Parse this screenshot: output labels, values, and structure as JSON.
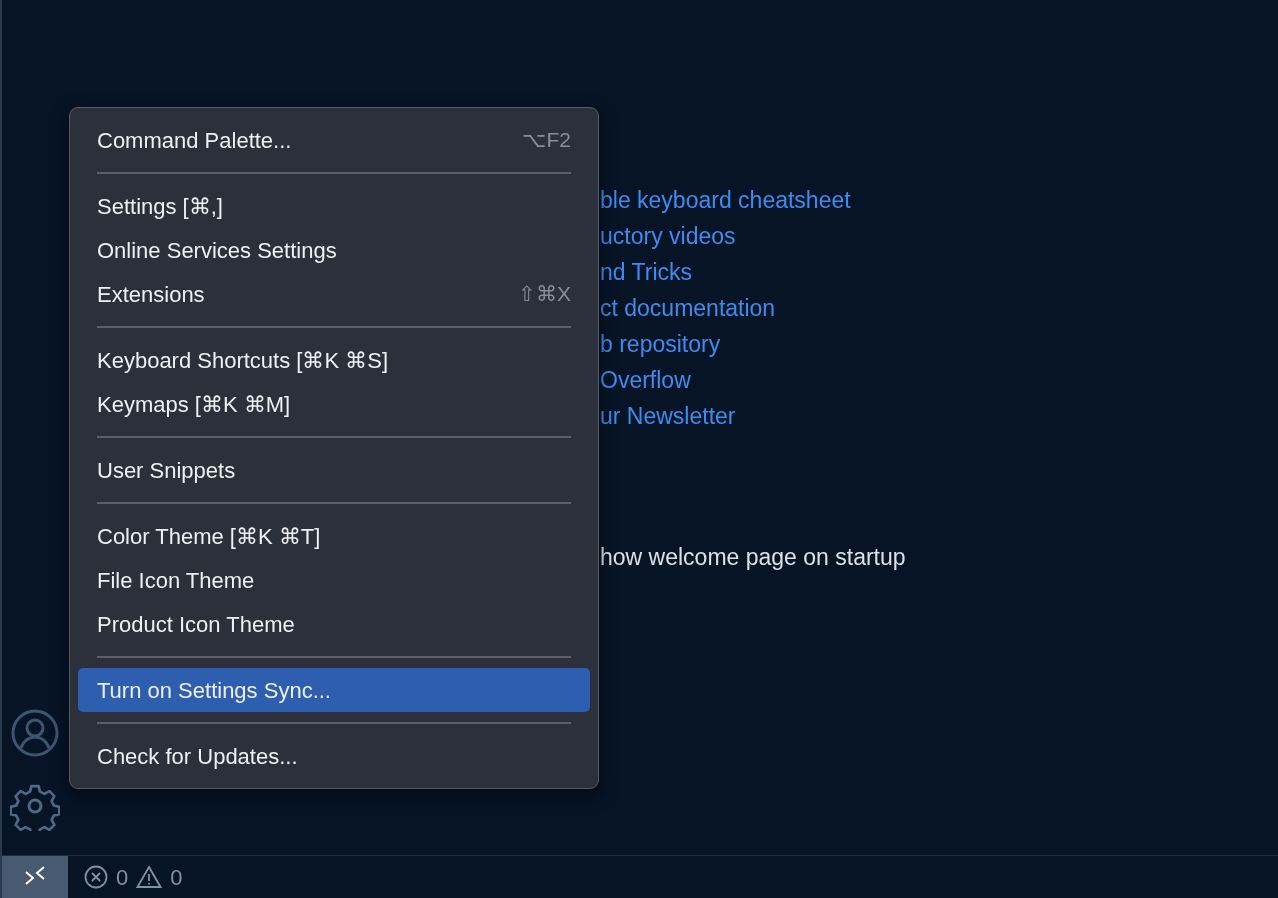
{
  "welcome": {
    "links": [
      "ble keyboard cheatsheet",
      "uctory videos",
      "nd Tricks",
      "ct documentation",
      "b repository",
      " Overflow",
      "ur Newsletter"
    ],
    "startup_text": "how welcome page on startup"
  },
  "menu": [
    {
      "kind": "item",
      "label": "Command Palette...",
      "shortcut": "⌥F2",
      "selected": false
    },
    {
      "kind": "separator"
    },
    {
      "kind": "item",
      "label": "Settings [⌘,]",
      "selected": false
    },
    {
      "kind": "item",
      "label": "Online Services Settings",
      "selected": false
    },
    {
      "kind": "item",
      "label": "Extensions",
      "shortcut": "⇧⌘X",
      "selected": false
    },
    {
      "kind": "separator"
    },
    {
      "kind": "item",
      "label": "Keyboard Shortcuts [⌘K ⌘S]",
      "selected": false
    },
    {
      "kind": "item",
      "label": "Keymaps [⌘K ⌘M]",
      "selected": false
    },
    {
      "kind": "separator"
    },
    {
      "kind": "item",
      "label": "User Snippets",
      "selected": false
    },
    {
      "kind": "separator"
    },
    {
      "kind": "item",
      "label": "Color Theme [⌘K ⌘T]",
      "selected": false
    },
    {
      "kind": "item",
      "label": "File Icon Theme",
      "selected": false
    },
    {
      "kind": "item",
      "label": "Product Icon Theme",
      "selected": false
    },
    {
      "kind": "separator"
    },
    {
      "kind": "item",
      "label": "Turn on Settings Sync...",
      "selected": true
    },
    {
      "kind": "separator"
    },
    {
      "kind": "item",
      "label": "Check for Updates...",
      "selected": false
    }
  ],
  "status_bar": {
    "errors": "0",
    "warnings": "0"
  }
}
